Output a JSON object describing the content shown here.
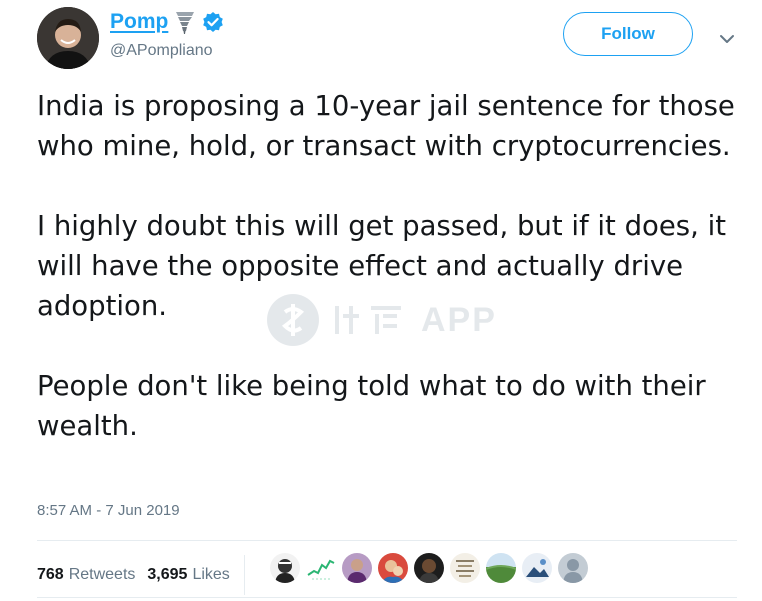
{
  "author": {
    "display_name": "Pomp",
    "handle": "@APompliano",
    "name_emoji_icon": "tornado-icon",
    "verified_icon": "verified-badge-icon"
  },
  "actions": {
    "follow_label": "Follow",
    "more_icon": "chevron-down-icon"
  },
  "tweet": {
    "paragraphs": [
      "India is proposing a 10-year jail sentence for those who mine, hold, or transact with cryptocurrencies.",
      "I highly doubt this will get passed, but if it does, it will have the opposite effect and actually drive adoption.",
      "People don't like being told what to do with their wealth."
    ],
    "timestamp": "8:57 AM - 7 Jun 2019"
  },
  "stats": {
    "retweets_count": "768",
    "retweets_label": "Retweets",
    "likes_count": "3,695",
    "likes_label": "Likes"
  },
  "likers": [
    {
      "icon": "liker-avatar-1"
    },
    {
      "icon": "liker-avatar-2"
    },
    {
      "icon": "liker-avatar-3"
    },
    {
      "icon": "liker-avatar-4"
    },
    {
      "icon": "liker-avatar-5"
    },
    {
      "icon": "liker-avatar-6"
    },
    {
      "icon": "liker-avatar-7"
    },
    {
      "icon": "liker-avatar-8"
    },
    {
      "icon": "liker-avatar-9"
    }
  ],
  "watermark": {
    "text": "APP"
  },
  "colors": {
    "accent": "#1da1f2",
    "text_primary": "#14171a",
    "text_secondary": "#657786",
    "divider": "#e6ecf0"
  }
}
